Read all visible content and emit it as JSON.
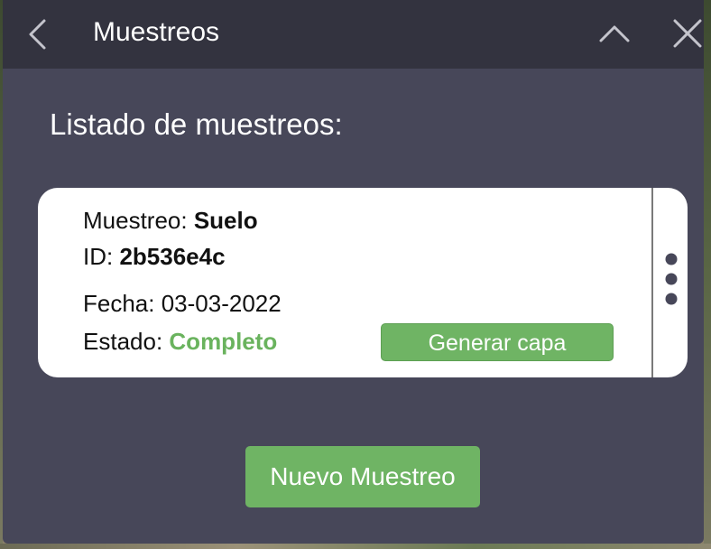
{
  "header": {
    "title": "Muestreos",
    "back_icon": "chevron-left-icon",
    "collapse_icon": "chevron-up-icon",
    "close_icon": "close-icon"
  },
  "main": {
    "heading": "Listado de muestreos:",
    "samples": [
      {
        "type_label": "Muestreo: ",
        "type_value": "Suelo",
        "id_label": "ID: ",
        "id_value": "2b536e4c",
        "date_label": "Fecha: ",
        "date_value": "03-03-2022",
        "status_label": "Estado: ",
        "status_value": "Completo",
        "status_color": "#6ab35e",
        "action_label": "Generar capa",
        "more_icon": "more-vertical-icon"
      }
    ],
    "new_button_label": "Nuevo Muestreo"
  },
  "colors": {
    "panel": "#474759",
    "header": "#33333f",
    "accent_green": "#6fb464"
  }
}
